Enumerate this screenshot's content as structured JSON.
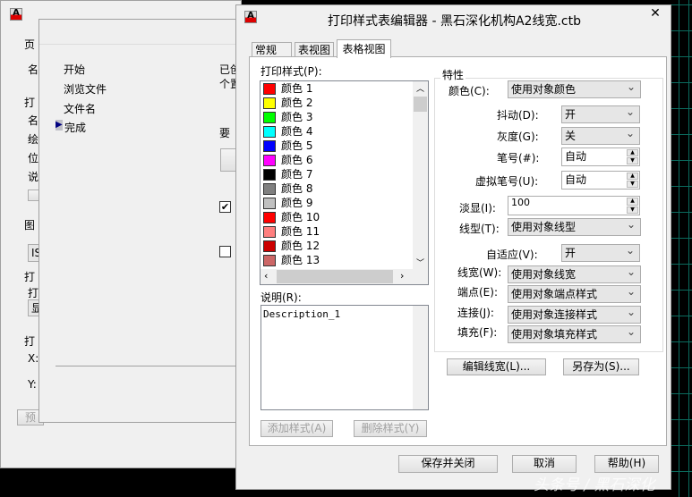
{
  "back_window": {
    "labels": [
      "页",
      "名",
      "打",
      "名",
      "绘",
      "位",
      "说",
      "图",
      "打",
      "打",
      "打",
      "X:",
      "Y:"
    ],
    "combo1": "IS",
    "combo2": "显",
    "preview_button": "预"
  },
  "wizard": {
    "steps": [
      "开始",
      "浏览文件",
      "文件名",
      "完成"
    ],
    "current_step": "完成",
    "text1": "已创",
    "text2": "个置",
    "text3": "要",
    "checkbox1_checked": true,
    "checkbox2_checked": false
  },
  "dialog": {
    "title": "打印样式表编辑器 - 黑石深化机构A2线宽.ctb",
    "tabs": [
      {
        "label": "常规",
        "active": false
      },
      {
        "label": "表视图",
        "active": false
      },
      {
        "label": "表格视图",
        "active": true
      }
    ],
    "styles_label": "打印样式(P):",
    "styles": [
      {
        "name": "颜色 1",
        "color": "#ff0000"
      },
      {
        "name": "颜色 2",
        "color": "#ffff00"
      },
      {
        "name": "颜色 3",
        "color": "#00ff00"
      },
      {
        "name": "颜色 4",
        "color": "#00ffff"
      },
      {
        "name": "颜色 5",
        "color": "#0000ff"
      },
      {
        "name": "颜色 6",
        "color": "#ff00ff"
      },
      {
        "name": "颜色 7",
        "color": "#000000"
      },
      {
        "name": "颜色 8",
        "color": "#808080"
      },
      {
        "name": "颜色 9",
        "color": "#c0c0c0"
      },
      {
        "name": "颜色 10",
        "color": "#ff0000"
      },
      {
        "name": "颜色 11",
        "color": "#ff7f7f"
      },
      {
        "name": "颜色 12",
        "color": "#cc0000"
      },
      {
        "name": "颜色 13",
        "color": "#cc6666"
      }
    ],
    "description_label": "说明(R):",
    "description": "Description_1",
    "add_style": "添加样式(A)",
    "delete_style": "删除样式(Y)",
    "properties": {
      "group_label": "特性",
      "color": {
        "label": "颜色(C):",
        "value": "使用对象颜色"
      },
      "dither": {
        "label": "抖动(D):",
        "value": "开"
      },
      "grayscale": {
        "label": "灰度(G):",
        "value": "关"
      },
      "pen": {
        "label": "笔号(#):",
        "value": "自动"
      },
      "virtual_pen": {
        "label": "虚拟笔号(U):",
        "value": "自动"
      },
      "screening": {
        "label": "淡显(I):",
        "value": "100"
      },
      "linetype": {
        "label": "线型(T):",
        "value": "使用对象线型"
      },
      "adaptive": {
        "label": "自适应(V):",
        "value": "开"
      },
      "lineweight": {
        "label": "线宽(W):",
        "value": "使用对象线宽"
      },
      "endstyle": {
        "label": "端点(E):",
        "value": "使用对象端点样式"
      },
      "joinstyle": {
        "label": "连接(J):",
        "value": "使用对象连接样式"
      },
      "fillstyle": {
        "label": "填充(F):",
        "value": "使用对象填充样式"
      }
    },
    "edit_lineweights": "编辑线宽(L)...",
    "save_as": "另存为(S)...",
    "save_close": "保存并关闭",
    "cancel": "取消",
    "help": "帮助(H)"
  },
  "watermark": "头条号 / 黑石深化"
}
